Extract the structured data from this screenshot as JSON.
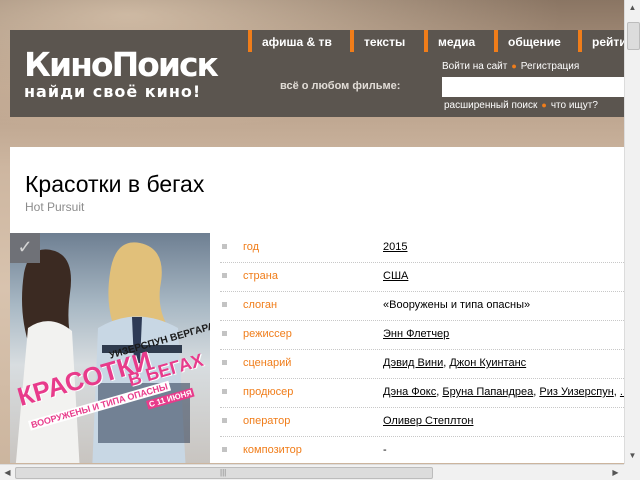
{
  "header": {
    "logo": {
      "brand": "КиноПоиск",
      "tagline": "найди своё кино!"
    },
    "nav": [
      "афиша & тв",
      "тексты",
      "медиа",
      "общение",
      "рейти"
    ],
    "search_tagline": "всё о любом фильме:",
    "user_links": [
      "Войти на сайт",
      "Регистрация"
    ],
    "search_links": [
      "расширенный поиск",
      "что ищут?"
    ],
    "search_value": ""
  },
  "movie": {
    "title": "Красотки в бегах",
    "original_title": "Hot Pursuit",
    "poster": {
      "names": "УИЗЕРСПУН  ВЕРГАРА",
      "title_line1": "КРАСОТКИ",
      "title_line2": "В БЕГАХ",
      "slogan": "ВООРУЖЕНЫ И ТИПА ОПАСНЫ",
      "release": "С 11 ИЮНЯ"
    },
    "info": [
      {
        "label": "год",
        "values": [
          "2015"
        ],
        "link": true
      },
      {
        "label": "страна",
        "values": [
          "США"
        ],
        "link": true
      },
      {
        "label": "слоган",
        "values": [
          "«Вооружены и типа опасны»"
        ],
        "link": false
      },
      {
        "label": "режиссер",
        "values": [
          "Энн Флетчер"
        ],
        "link": true
      },
      {
        "label": "сценарий",
        "values": [
          "Дэвид Вини",
          "Джон Куинтанс"
        ],
        "link": true
      },
      {
        "label": "продюсер",
        "values": [
          "Дэна Фокс",
          "Бруна Папандреа",
          "Риз Уизерспун",
          "..."
        ],
        "link": true
      },
      {
        "label": "оператор",
        "values": [
          "Оливер Степлтон"
        ],
        "link": true
      },
      {
        "label": "композитор",
        "values": [
          "-"
        ],
        "link": false
      }
    ]
  },
  "colors": {
    "accent": "#f07d1a",
    "header_bg": "#5b554f"
  }
}
